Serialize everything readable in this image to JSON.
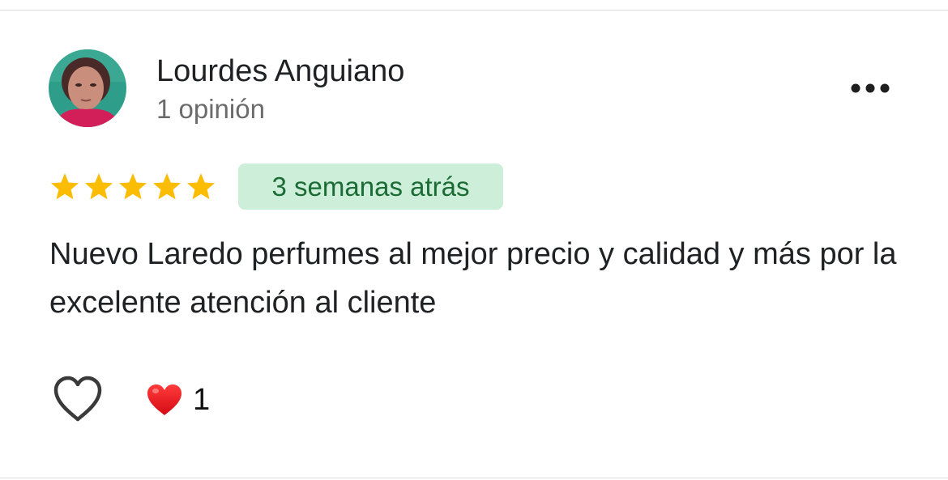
{
  "reviewer": {
    "name": "Lourdes Anguiano",
    "review_count": "1 opinión",
    "avatar_icon": "profile-photo"
  },
  "menu": {
    "icon": "more-horizontal-icon"
  },
  "review": {
    "rating": 5,
    "rating_max": 5,
    "star_color": "#fbbc04",
    "time_ago": "3 semanas atrás",
    "badge_background": "#cdeed8",
    "badge_text_color": "#1a6b34",
    "text": "Nuevo Laredo perfumes al mejor precio y calidad y más por la excelente atención al cliente"
  },
  "reactions": {
    "like_icon": "heart-outline-icon",
    "summary_icon": "red-heart-icon",
    "count": "1"
  }
}
